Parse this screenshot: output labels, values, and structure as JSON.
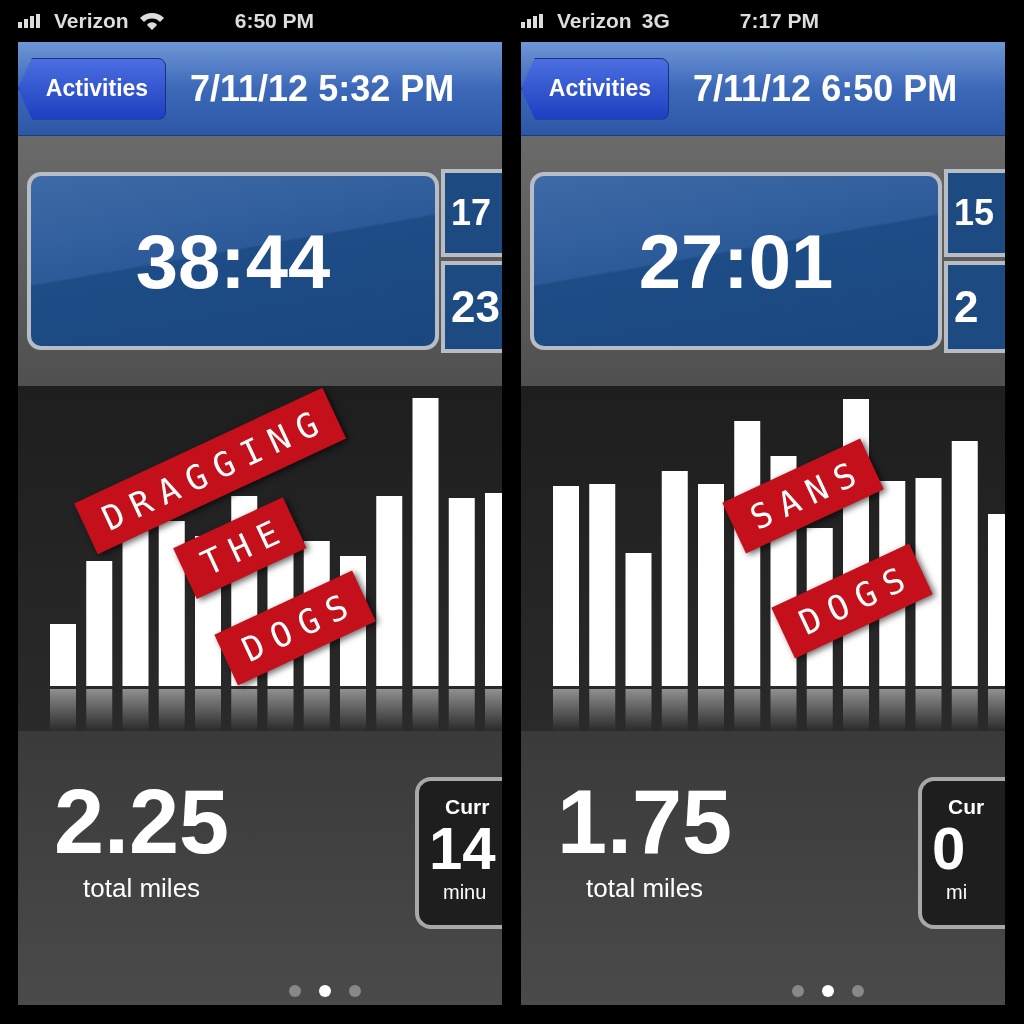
{
  "panels": [
    {
      "status_bar": {
        "carrier": "Verizon",
        "connection": {
          "kind": "wifi"
        },
        "time": "6:50 PM"
      },
      "nav": {
        "back_button": "Activities",
        "title": "7/11/12 5:32 PM"
      },
      "timer": "38:44",
      "side_stats": [
        "17",
        "23"
      ],
      "stickers": [
        {
          "text": "DRAGGING"
        },
        {
          "text": "THE"
        },
        {
          "text": "DOGS"
        }
      ],
      "total": {
        "value": "2.25",
        "label": "total miles"
      },
      "current_card": {
        "title": "Curr",
        "value": "14",
        "unit": "minu"
      },
      "page_dots": [
        {
          "selected": false
        },
        {
          "selected": true
        },
        {
          "selected": false
        }
      ]
    },
    {
      "status_bar": {
        "carrier": "Verizon",
        "connection": {
          "kind": "label",
          "text": "3G"
        },
        "time": "7:17 PM"
      },
      "nav": {
        "back_button": "Activities",
        "title": "7/11/12 6:50 PM"
      },
      "timer": "27:01",
      "side_stats": [
        "15",
        "2"
      ],
      "stickers": [
        {
          "text": "SANS"
        },
        {
          "text": "DOGS"
        }
      ],
      "total": {
        "value": "1.75",
        "label": "total miles"
      },
      "current_card": {
        "title": "Cur",
        "value": "0",
        "unit": "mi"
      },
      "page_dots": [
        {
          "selected": false
        },
        {
          "selected": true
        },
        {
          "selected": false
        }
      ]
    }
  ]
}
